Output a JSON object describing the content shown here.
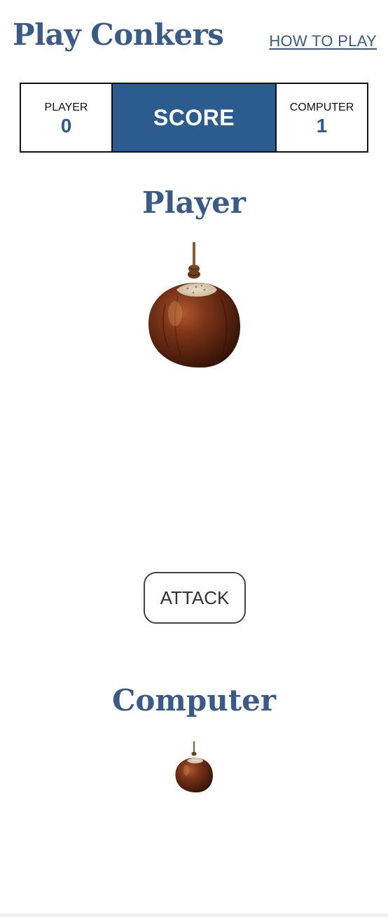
{
  "header": {
    "title": "Play Conkers",
    "how_to_play_label": "HOW TO PLAY"
  },
  "scoreboard": {
    "player_label": "PLAYER",
    "player_score": "0",
    "center_label": "SCORE",
    "computer_label": "COMPUTER",
    "computer_score": "1"
  },
  "player_section": {
    "heading": "Player",
    "conker_icon": "conker-icon"
  },
  "attack_button": {
    "label": "ATTACK"
  },
  "computer_section": {
    "heading": "Computer",
    "conker_icon": "conker-icon"
  },
  "colors": {
    "brand_blue": "#3a5a8a",
    "score_bar_blue": "#2b5c8f",
    "conker_brown": "#5a2a14"
  }
}
